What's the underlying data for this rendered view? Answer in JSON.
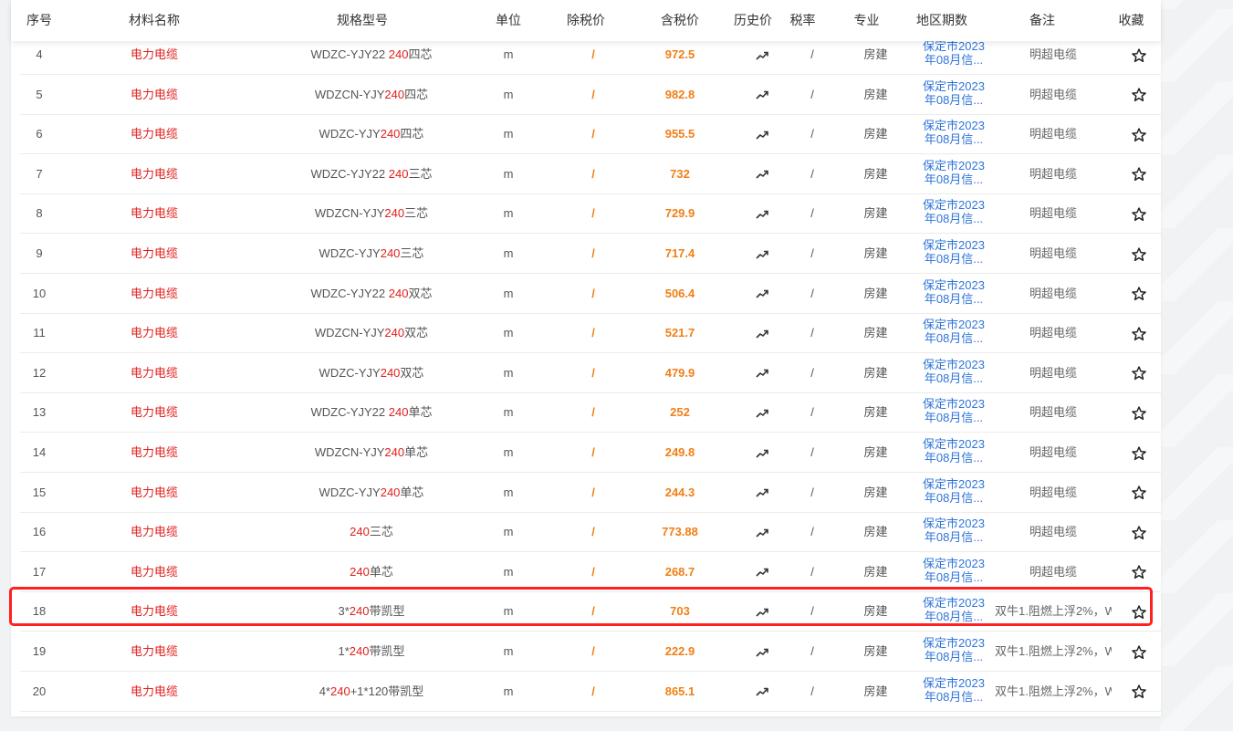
{
  "headers": {
    "index": "序号",
    "material": "材料名称",
    "spec": "规格型号",
    "unit": "单位",
    "pretax": "除税价",
    "taxprice": "含税价",
    "history": "历史价",
    "taxrate": "税率",
    "specialty": "专业",
    "region": "地区期数",
    "note": "备注",
    "favorite": "收藏"
  },
  "rows": [
    {
      "index": "4",
      "material": "电力电缆",
      "spec_pre": "WDZC-YJY22 ",
      "spec_hl": "240",
      "spec_post": "四芯",
      "unit": "m",
      "pretax": "/",
      "price": "972.5",
      "taxrate": "/",
      "specialty": "房建",
      "region1": "保定市2023",
      "region2": "年08月信...",
      "note": "明超电缆"
    },
    {
      "index": "5",
      "material": "电力电缆",
      "spec_pre": "WDZCN-YJY",
      "spec_hl": "240",
      "spec_post": "四芯",
      "unit": "m",
      "pretax": "/",
      "price": "982.8",
      "taxrate": "/",
      "specialty": "房建",
      "region1": "保定市2023",
      "region2": "年08月信...",
      "note": "明超电缆"
    },
    {
      "index": "6",
      "material": "电力电缆",
      "spec_pre": "WDZC-YJY",
      "spec_hl": "240",
      "spec_post": "四芯",
      "unit": "m",
      "pretax": "/",
      "price": "955.5",
      "taxrate": "/",
      "specialty": "房建",
      "region1": "保定市2023",
      "region2": "年08月信...",
      "note": "明超电缆"
    },
    {
      "index": "7",
      "material": "电力电缆",
      "spec_pre": "WDZC-YJY22 ",
      "spec_hl": "240",
      "spec_post": "三芯",
      "unit": "m",
      "pretax": "/",
      "price": "732",
      "taxrate": "/",
      "specialty": "房建",
      "region1": "保定市2023",
      "region2": "年08月信...",
      "note": "明超电缆"
    },
    {
      "index": "8",
      "material": "电力电缆",
      "spec_pre": "WDZCN-YJY",
      "spec_hl": "240",
      "spec_post": "三芯",
      "unit": "m",
      "pretax": "/",
      "price": "729.9",
      "taxrate": "/",
      "specialty": "房建",
      "region1": "保定市2023",
      "region2": "年08月信...",
      "note": "明超电缆"
    },
    {
      "index": "9",
      "material": "电力电缆",
      "spec_pre": "WDZC-YJY",
      "spec_hl": "240",
      "spec_post": "三芯",
      "unit": "m",
      "pretax": "/",
      "price": "717.4",
      "taxrate": "/",
      "specialty": "房建",
      "region1": "保定市2023",
      "region2": "年08月信...",
      "note": "明超电缆"
    },
    {
      "index": "10",
      "material": "电力电缆",
      "spec_pre": "WDZC-YJY22 ",
      "spec_hl": "240",
      "spec_post": "双芯",
      "unit": "m",
      "pretax": "/",
      "price": "506.4",
      "taxrate": "/",
      "specialty": "房建",
      "region1": "保定市2023",
      "region2": "年08月信...",
      "note": "明超电缆"
    },
    {
      "index": "11",
      "material": "电力电缆",
      "spec_pre": "WDZCN-YJY",
      "spec_hl": "240",
      "spec_post": "双芯",
      "unit": "m",
      "pretax": "/",
      "price": "521.7",
      "taxrate": "/",
      "specialty": "房建",
      "region1": "保定市2023",
      "region2": "年08月信...",
      "note": "明超电缆"
    },
    {
      "index": "12",
      "material": "电力电缆",
      "spec_pre": "WDZC-YJY",
      "spec_hl": "240",
      "spec_post": "双芯",
      "unit": "m",
      "pretax": "/",
      "price": "479.9",
      "taxrate": "/",
      "specialty": "房建",
      "region1": "保定市2023",
      "region2": "年08月信...",
      "note": "明超电缆"
    },
    {
      "index": "13",
      "material": "电力电缆",
      "spec_pre": "WDZC-YJY22 ",
      "spec_hl": "240",
      "spec_post": "单芯",
      "unit": "m",
      "pretax": "/",
      "price": "252",
      "taxrate": "/",
      "specialty": "房建",
      "region1": "保定市2023",
      "region2": "年08月信...",
      "note": "明超电缆"
    },
    {
      "index": "14",
      "material": "电力电缆",
      "spec_pre": "WDZCN-YJY",
      "spec_hl": "240",
      "spec_post": "单芯",
      "unit": "m",
      "pretax": "/",
      "price": "249.8",
      "taxrate": "/",
      "specialty": "房建",
      "region1": "保定市2023",
      "region2": "年08月信...",
      "note": "明超电缆"
    },
    {
      "index": "15",
      "material": "电力电缆",
      "spec_pre": "WDZC-YJY",
      "spec_hl": "240",
      "spec_post": "单芯",
      "unit": "m",
      "pretax": "/",
      "price": "244.3",
      "taxrate": "/",
      "specialty": "房建",
      "region1": "保定市2023",
      "region2": "年08月信...",
      "note": "明超电缆"
    },
    {
      "index": "16",
      "material": "电力电缆",
      "spec_pre": "",
      "spec_hl": "240",
      "spec_post": "三芯",
      "unit": "m",
      "pretax": "/",
      "price": "773.88",
      "taxrate": "/",
      "specialty": "房建",
      "region1": "保定市2023",
      "region2": "年08月信...",
      "note": "明超电缆"
    },
    {
      "index": "17",
      "material": "电力电缆",
      "spec_pre": "",
      "spec_hl": "240",
      "spec_post": "单芯",
      "unit": "m",
      "pretax": "/",
      "price": "268.7",
      "taxrate": "/",
      "specialty": "房建",
      "region1": "保定市2023",
      "region2": "年08月信...",
      "note": "明超电缆"
    },
    {
      "index": "18",
      "material": "电力电缆",
      "spec_pre": "3*",
      "spec_hl": "240",
      "spec_post": "带凯型",
      "unit": "m",
      "pretax": "/",
      "price": "703",
      "taxrate": "/",
      "specialty": "房建",
      "region1": "保定市2023",
      "region2": "年08月信...",
      "note": "双牛1.阻燃上浮2%，W"
    },
    {
      "index": "19",
      "material": "电力电缆",
      "spec_pre": "1*",
      "spec_hl": "240",
      "spec_post": "带凯型",
      "unit": "m",
      "pretax": "/",
      "price": "222.9",
      "taxrate": "/",
      "specialty": "房建",
      "region1": "保定市2023",
      "region2": "年08月信...",
      "note": "双牛1.阻燃上浮2%，W"
    },
    {
      "index": "20",
      "material": "电力电缆",
      "spec_pre": "4*",
      "spec_hl": "240",
      "spec_post": "+1*120带凯型",
      "unit": "m",
      "pretax": "/",
      "price": "865.1",
      "taxrate": "/",
      "specialty": "房建",
      "region1": "保定市2023",
      "region2": "年08月信...",
      "note": "双牛1.阻燃上浮2%，W"
    }
  ],
  "icons": {
    "history": "trend-up-icon",
    "favorite": "star-outline-icon"
  },
  "colors": {
    "accent": "#1e6fff",
    "material": "#e0201d",
    "price": "#f07f16",
    "region": "#2f74d9",
    "highlight": "#ff2020"
  }
}
